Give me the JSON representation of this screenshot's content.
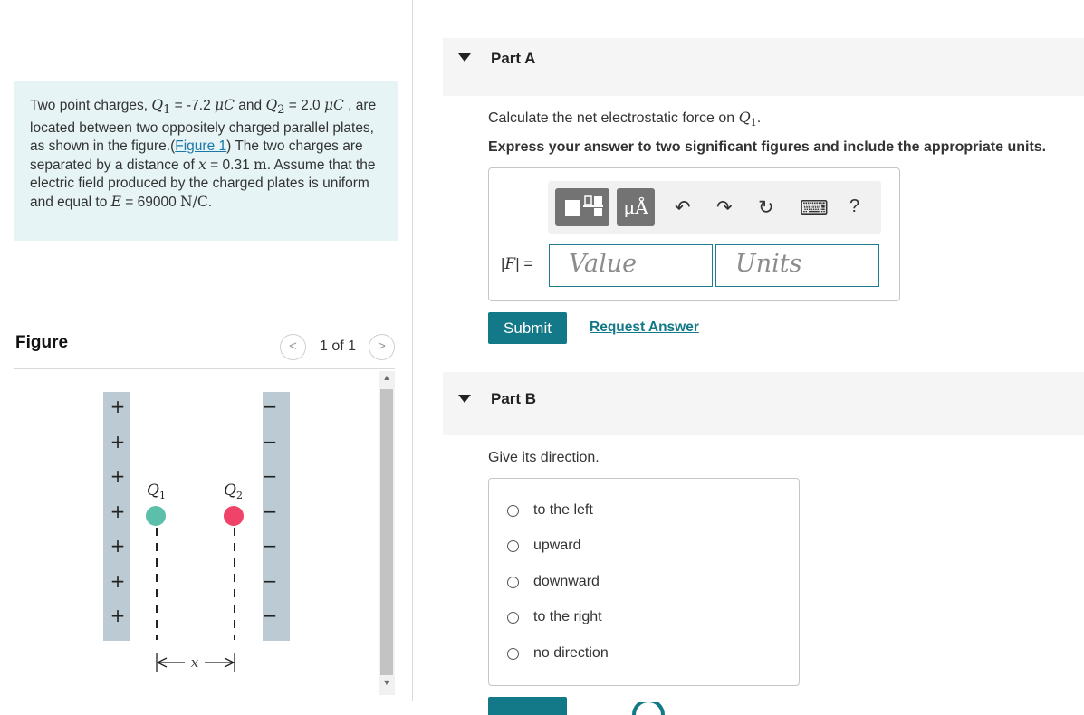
{
  "problem": {
    "intro": "Two point charges, ",
    "q1_sym": "Q",
    "q1_sub": "1",
    "q1_eq": " = -7.2 ",
    "q1_unit": "μC",
    "and": " and ",
    "q2_sym": "Q",
    "q2_sub": "2",
    "q2_eq": " = 2.0 ",
    "q2_unit": "μC",
    "comma": " ,",
    "mid1": " are located between two oppositely charged parallel plates, as shown in the figure.(",
    "figure_link": "Figure 1",
    "mid2": ") The two charges are separated by a distance of ",
    "x_sym": "x",
    "x_eq": " = 0.31 ",
    "x_unit": "m",
    "mid3": ". Assume that the electric field produced by the charged plates is uniform and equal to ",
    "e_sym": "E",
    "e_eq": " = 69000 ",
    "e_unit": "N/C",
    "end": "."
  },
  "figure": {
    "title": "Figure",
    "prev_glyph": "<",
    "next_glyph": ">",
    "counter": "1 of 1",
    "plus_sign": "+",
    "minus_sign": "−",
    "q1_label": "Q",
    "q1_sub": "1",
    "q2_label": "Q",
    "q2_sub": "2",
    "x_label": "x",
    "q1_color": "#5bbfaa",
    "q2_color": "#f0436a",
    "plate_color": "#bccbd3"
  },
  "partA": {
    "title": "Part A",
    "question_prefix": "Calculate the net electrostatic force on ",
    "q_sym": "Q",
    "q_sub": "1",
    "question_suffix": ".",
    "instruction": "Express your answer to two significant figures and include the appropriate units.",
    "toolbar": {
      "templates_icon": "templates-icon",
      "units_label": "μÅ",
      "undo": "↶",
      "redo": "↷",
      "reset": "↻",
      "keyboard": "⌨",
      "help": "?"
    },
    "f_label_bar1": "|",
    "f_label_sym": "F",
    "f_label_bar2": "| =",
    "value_placeholder": "Value",
    "units_placeholder": "Units",
    "submit": "Submit",
    "request": "Request Answer"
  },
  "partB": {
    "title": "Part B",
    "question": "Give its direction.",
    "options": [
      "to the left",
      "upward",
      "downward",
      "to the right",
      "no direction"
    ]
  },
  "colors": {
    "accent": "#137887",
    "link": "#1a77a8",
    "problem_bg": "#e6f4f6",
    "header_bg": "#f5f5f5"
  }
}
